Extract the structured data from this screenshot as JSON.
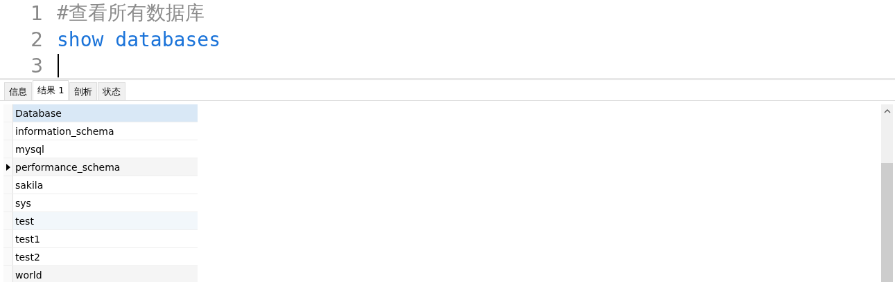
{
  "editor": {
    "lines": [
      {
        "number": "1",
        "kind": "comment",
        "text": "#查看所有数据库"
      },
      {
        "number": "2",
        "kind": "keyword",
        "text": "show databases"
      },
      {
        "number": "3",
        "kind": "cursor"
      }
    ]
  },
  "tabs": [
    {
      "label": "信息",
      "selected": false
    },
    {
      "label": "结果 1",
      "selected": true
    },
    {
      "label": "剖析",
      "selected": false
    },
    {
      "label": "状态",
      "selected": false
    }
  ],
  "grid": {
    "columns": [
      "Database"
    ],
    "rows": [
      {
        "cells": [
          "information_schema"
        ],
        "current": false
      },
      {
        "cells": [
          "mysql"
        ],
        "current": false
      },
      {
        "cells": [
          "performance_schema"
        ],
        "current": true
      },
      {
        "cells": [
          "sakila"
        ],
        "current": false
      },
      {
        "cells": [
          "sys"
        ],
        "current": false
      },
      {
        "cells": [
          "test"
        ],
        "current": false
      },
      {
        "cells": [
          "test1"
        ],
        "current": false
      },
      {
        "cells": [
          "test2"
        ],
        "current": false
      },
      {
        "cells": [
          "world"
        ],
        "current": false
      }
    ]
  }
}
